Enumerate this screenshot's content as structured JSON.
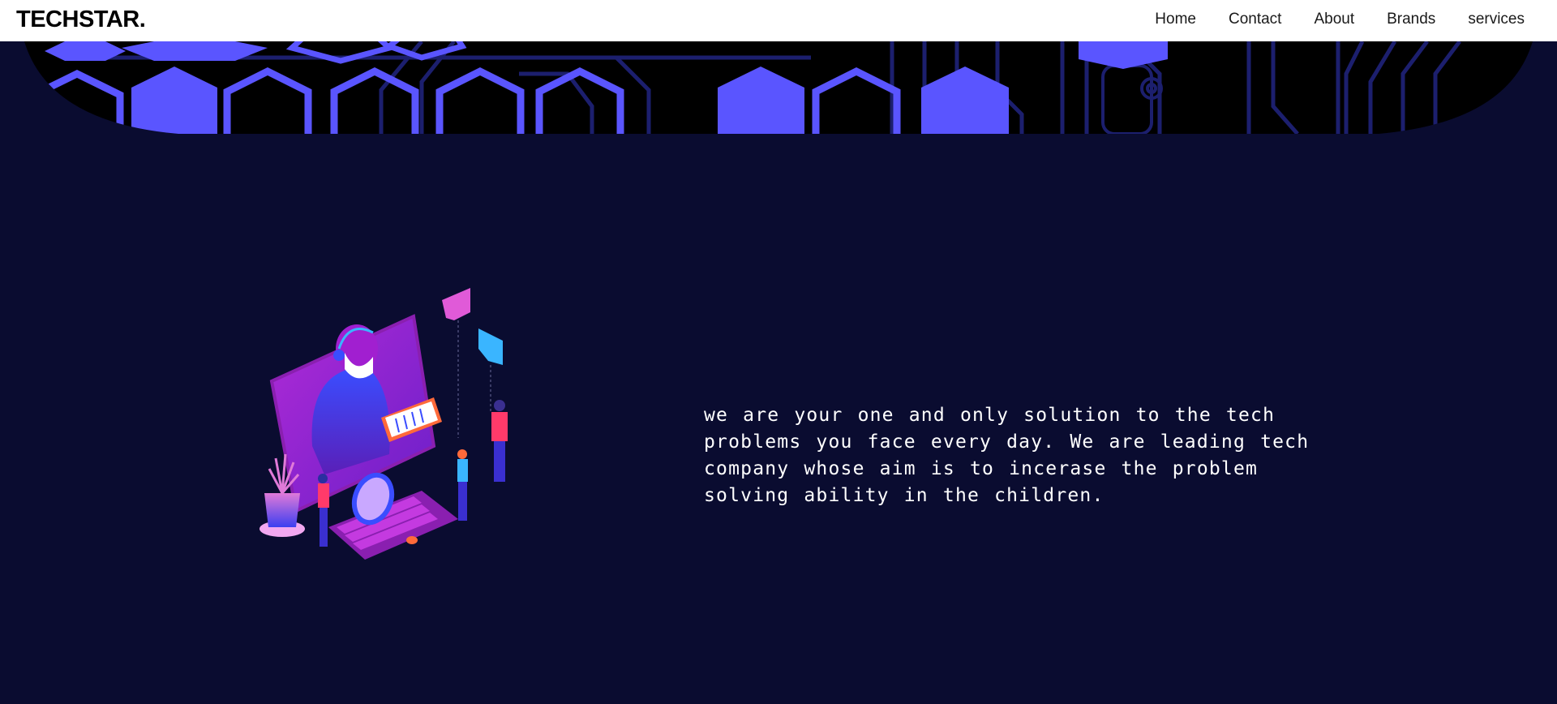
{
  "header": {
    "brand": "TECHSTAR.",
    "nav": [
      {
        "label": "Home"
      },
      {
        "label": "Contact"
      },
      {
        "label": "About"
      },
      {
        "label": "Brands"
      },
      {
        "label": "services"
      }
    ]
  },
  "about": {
    "text": "we are your one and only solution to the tech problems you face every day. We are leading tech company whose aim is to incerase the problem solving ability in the children."
  },
  "colors": {
    "background": "#0a0c30",
    "accent": "#5a55ff",
    "navbar": "#ffffff"
  },
  "icons": {
    "banner": "circuit-hexagon-pattern",
    "illustration": "support-agent-computer-illustration"
  }
}
